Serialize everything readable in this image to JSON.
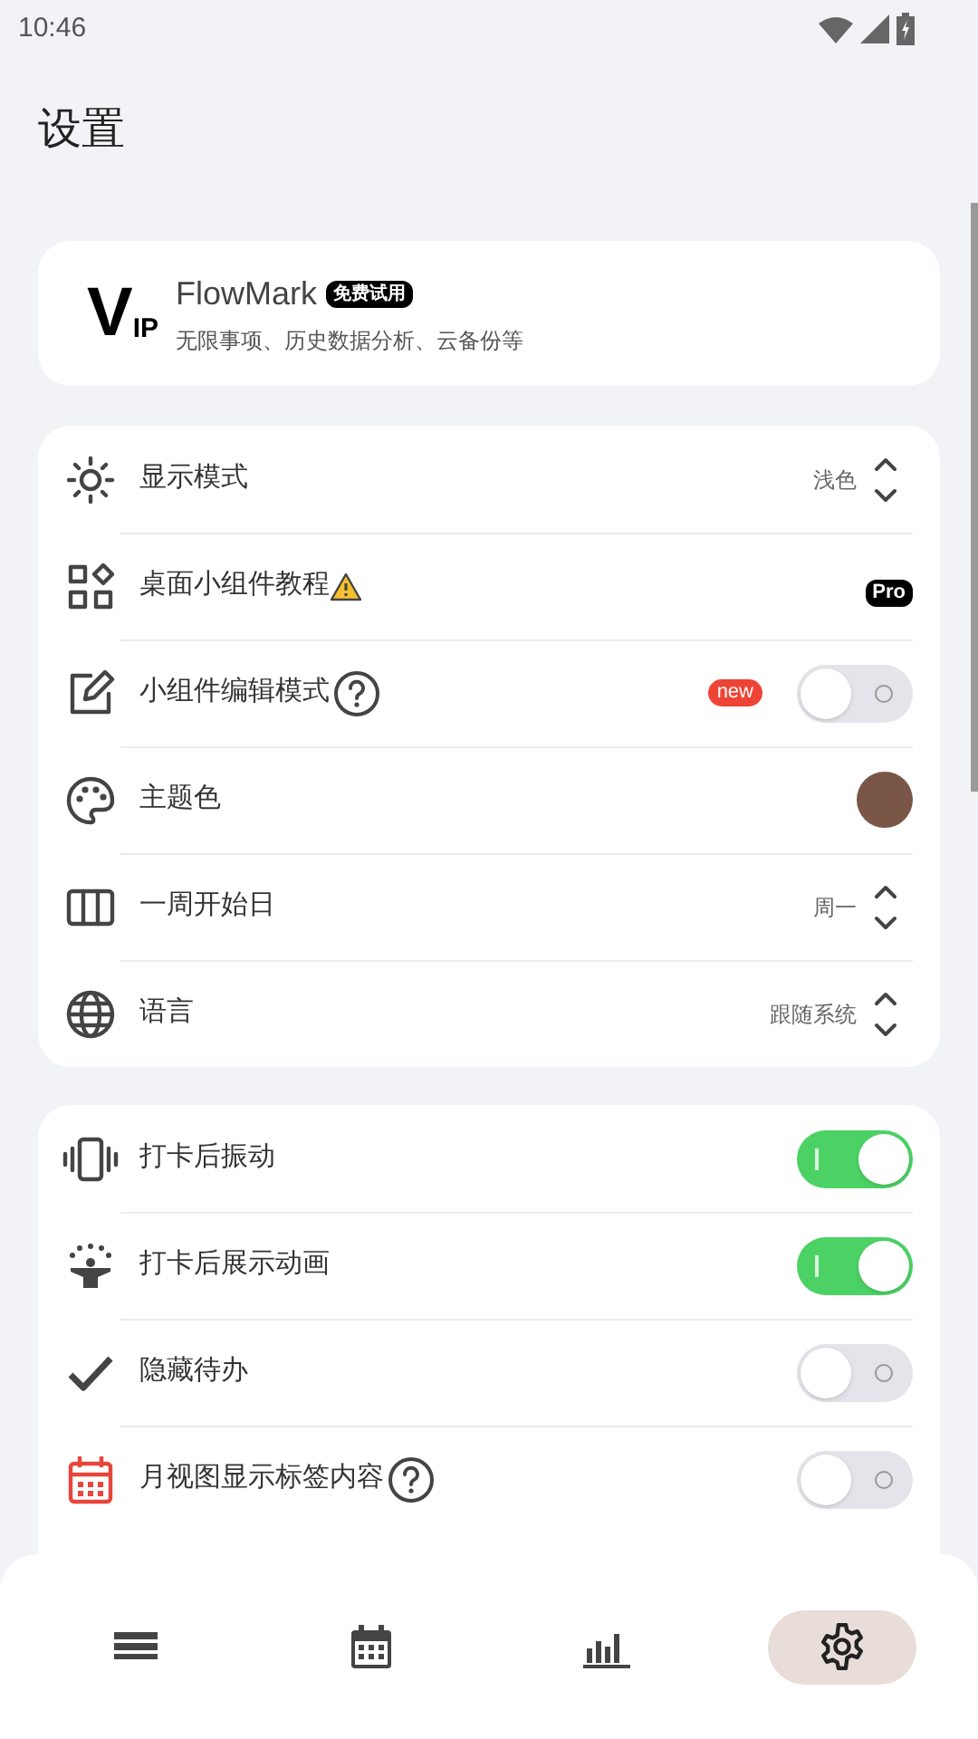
{
  "status_bar": {
    "time": "10:46"
  },
  "title": "设置",
  "vip_card": {
    "logo_mark": "V",
    "logo_text": "IP",
    "name": "FlowMark",
    "badge": "免费试用",
    "subtitle": "无限事项、历史数据分析、云备份等"
  },
  "general_settings": [
    {
      "kind": "select",
      "label": "显示模式",
      "value": "浅色"
    },
    {
      "kind": "badge",
      "label": "桌面小组件教程",
      "warning": true,
      "badge": "Pro"
    },
    {
      "kind": "toggle",
      "label": "小组件编辑模式",
      "help": true,
      "badge": "new",
      "on": false
    },
    {
      "kind": "color",
      "label": "主题色",
      "color": "#7a5646"
    },
    {
      "kind": "select",
      "label": "一周开始日",
      "value": "周一"
    },
    {
      "kind": "select",
      "label": "语言",
      "value": "跟随系统"
    }
  ],
  "feedback_settings": [
    {
      "kind": "toggle",
      "label": "打卡后振动",
      "on": true
    },
    {
      "kind": "toggle",
      "label": "打卡后展示动画",
      "on": true
    },
    {
      "kind": "toggle",
      "label": "隐藏待办",
      "on": false
    },
    {
      "kind": "toggle",
      "label": "月视图显示标签内容",
      "help": true,
      "on": false
    }
  ],
  "bottom_nav": [
    {
      "selected": false
    },
    {
      "selected": false
    },
    {
      "selected": false
    },
    {
      "selected": true
    }
  ]
}
